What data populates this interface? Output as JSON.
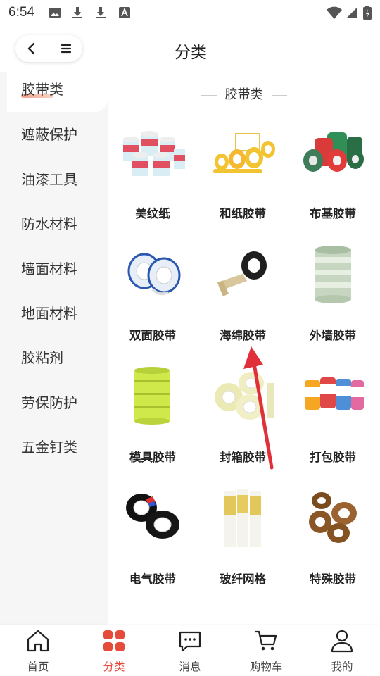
{
  "status_bar": {
    "time": "6:54"
  },
  "header": {
    "title": "分类"
  },
  "sidebar": {
    "items": [
      {
        "label": "胶带类",
        "active": true
      },
      {
        "label": "遮蔽保护"
      },
      {
        "label": "油漆工具"
      },
      {
        "label": "防水材料"
      },
      {
        "label": "墙面材料"
      },
      {
        "label": "地面材料"
      },
      {
        "label": "胶粘剂"
      },
      {
        "label": "劳保防护"
      },
      {
        "label": "五金钉类"
      }
    ]
  },
  "content": {
    "section_title": "胶带类",
    "products": [
      {
        "label": "美纹纸",
        "icon": "masking-paper-tape-icon"
      },
      {
        "label": "和纸胶带",
        "icon": "washi-tape-icon"
      },
      {
        "label": "布基胶带",
        "icon": "cloth-tape-icon"
      },
      {
        "label": "双面胶带",
        "icon": "double-sided-tape-icon"
      },
      {
        "label": "海绵胶带",
        "icon": "foam-tape-icon"
      },
      {
        "label": "外墙胶带",
        "icon": "exterior-wall-tape-icon"
      },
      {
        "label": "模具胶带",
        "icon": "mold-tape-icon"
      },
      {
        "label": "封箱胶带",
        "icon": "sealing-tape-icon"
      },
      {
        "label": "打包胶带",
        "icon": "packing-tape-icon"
      },
      {
        "label": "电气胶带",
        "icon": "electrical-tape-icon"
      },
      {
        "label": "玻纤网格",
        "icon": "fiberglass-mesh-icon"
      },
      {
        "label": "特殊胶带",
        "icon": "special-tape-icon"
      }
    ]
  },
  "tabbar": {
    "tabs": [
      {
        "label": "首页",
        "icon": "home-icon"
      },
      {
        "label": "分类",
        "icon": "category-icon",
        "active": true
      },
      {
        "label": "消息",
        "icon": "message-icon"
      },
      {
        "label": "购物车",
        "icon": "cart-icon"
      },
      {
        "label": "我的",
        "icon": "profile-icon"
      }
    ]
  },
  "colors": {
    "accent": "#e64a3b",
    "sidebar_bg": "#f6f6f6",
    "arrow": "#e0303a"
  }
}
